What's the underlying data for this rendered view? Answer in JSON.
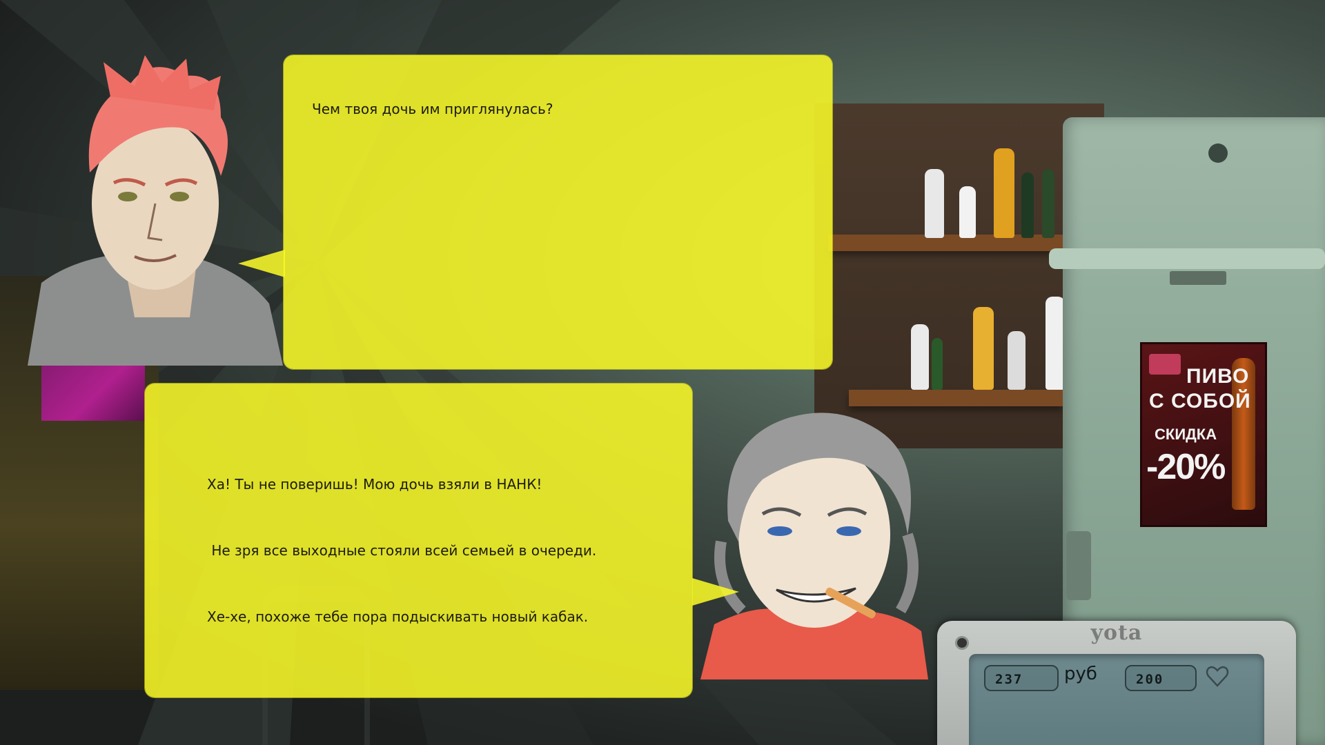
{
  "dialogue": {
    "player_line": "Чем твоя дочь им приглянулась?",
    "customer_lines": [
      "Ха! Ты не поверишь! Мою дочь взяли в НАНК!",
      " Не зря все выходные стояли всей семьей в очереди.",
      "Хе-хе, похоже тебе пора подыскивать новый кабак."
    ]
  },
  "poster": {
    "line1": "ПИВО",
    "line2": "С СОБОЙ",
    "line3": "СКИДКА",
    "line4": "-20%"
  },
  "phone": {
    "brand": "yota",
    "money": "237",
    "money_unit": "руб",
    "health": "200"
  },
  "colors": {
    "bubble": "#f8f828",
    "phone_screen": "#6f8a8f",
    "poster_bg": "#5a1416"
  },
  "icons": {
    "health": "heart-icon"
  }
}
